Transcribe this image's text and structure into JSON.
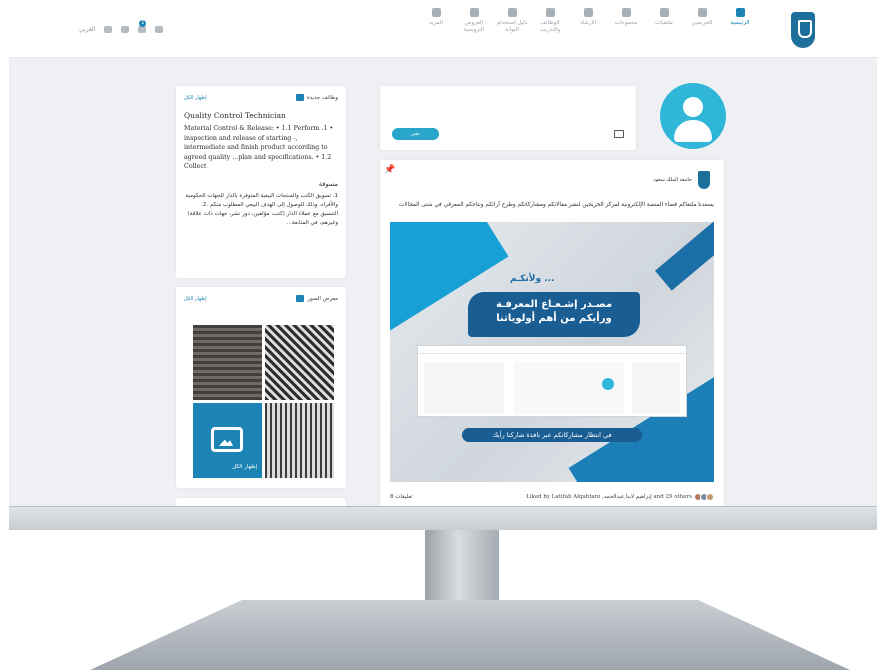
{
  "nav": {
    "items": [
      {
        "label": "الرئيسية",
        "icon": "home-icon",
        "active": true
      },
      {
        "label": "الخريجين",
        "icon": "id-card-icon",
        "active": false
      },
      {
        "label": "ملتقيات",
        "icon": "graduation-cap-icon",
        "active": false
      },
      {
        "label": "مجموعات",
        "icon": "building-icon",
        "active": false
      },
      {
        "label": "الارشاد",
        "icon": "users-icon",
        "active": false
      },
      {
        "label": "الوظائف والتدريب",
        "icon": "briefcase-icon",
        "active": false
      },
      {
        "label": "دليل استخدام البوابة",
        "icon": "link-icon",
        "active": false
      },
      {
        "label": "العروض الترويجية",
        "icon": "link-icon",
        "active": false
      },
      {
        "label": "المزيد",
        "icon": "more-icon",
        "active": false
      }
    ],
    "lang_label": "العربي",
    "notification_count": "1"
  },
  "jobs_card": {
    "title": "وظائف جديدة",
    "link": "إظهار الكل",
    "job1_title": "Quality Control Technician",
    "job1_desc": "Material Control & Release: • 1.1 Perform .1 • inspection and release of starting -, intermediate and finish product according to agreed quality ...plan and specifications. • 1.2 Collect",
    "job2_title": "مسوقة",
    "job2_desc": "1. تسويق الكتب والمنتجات البيعية المتوفرة بالدار للجهات الحكومية والأفراد، وذلك للوصول إلى الهدف البيعي المطلوب منكم .2. التنسيق مع عملاء الدار (كتب، مؤلفين، دور نشر، جهات ذات علاقة) وغيرهم، في المتابعة..."
  },
  "gallery_card": {
    "title": "معرض الصور",
    "link": "إظهار الكل",
    "more_label": "إظهار الكل"
  },
  "composer": {
    "publish_label": "نشر"
  },
  "post": {
    "author": "جامعة الملك سعود",
    "text": "يسعدنا ملتقاكم فضاء المنصة الإلكترونية لمركز الخريجين لنشر مقالاتكم ومشاركاتكم وطرح آرائكم ونتاجكم المعرفي في شتى المجالات",
    "banner_tag": "... ولأنكـم",
    "banner_line1": "مصـدر إشـعـاع المعرفـة",
    "banner_line2": "ورأيكم من أهم أولوياتنا",
    "banner_cta": "في انتظار مشاركاتكم عبر نافذة شاركنا رأيك",
    "likes_text": "Liked by Latifah Alqahtani ,إبراهيم لابنا,عبدالحمد and 29 others",
    "comments_text": "8 تعليقات"
  },
  "colors": {
    "accent": "#1b84b5",
    "avatar": "#2fb6d8",
    "banner_dark": "#1a5d93"
  }
}
